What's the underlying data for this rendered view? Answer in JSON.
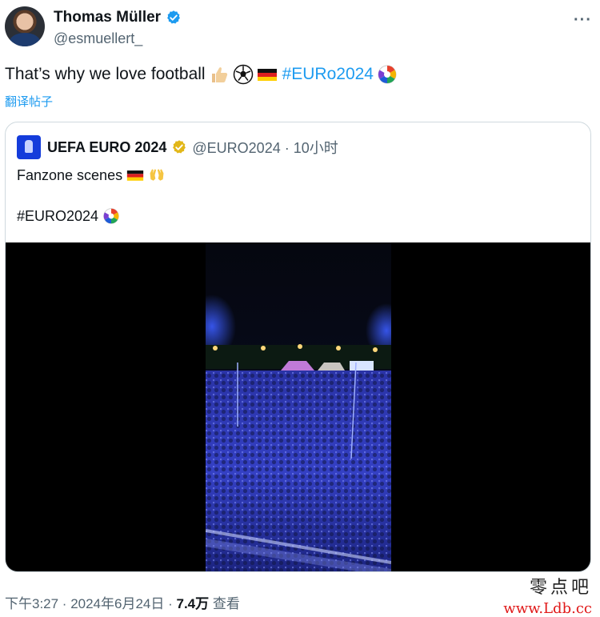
{
  "author": {
    "name": "Thomas Müller",
    "handle": "@esmuellert_"
  },
  "tweet": {
    "text": "That’s why we love football",
    "hashtag": "#EURo2024",
    "translate_label": "翻译帖子"
  },
  "quoted": {
    "name": "UEFA EURO 2024",
    "handle_time": "@EURO2024 · 10小时",
    "line1": "Fanzone scenes",
    "line2": "#EURO2024"
  },
  "meta": {
    "time_date": "下午3:27 · 2024年6月24日 · ",
    "views_count": "7.4万",
    "views_label": "查看"
  },
  "watermark": {
    "site_cn": "零点吧",
    "site_url": "www.Ldb.cc"
  },
  "colors": {
    "link_blue": "#1d9bf0",
    "secondary_gray": "#536471",
    "gold_badge": "#e2b719",
    "watermark_red": "#e01919"
  },
  "icons": [
    "verified-badge-icon",
    "gold-verified-badge-icon",
    "more-options-icon",
    "thumbs-up-emoji-icon",
    "soccer-ball-emoji-icon",
    "germany-flag-emoji-icon",
    "euro-hashflag-icon",
    "raised-hands-emoji-icon"
  ]
}
